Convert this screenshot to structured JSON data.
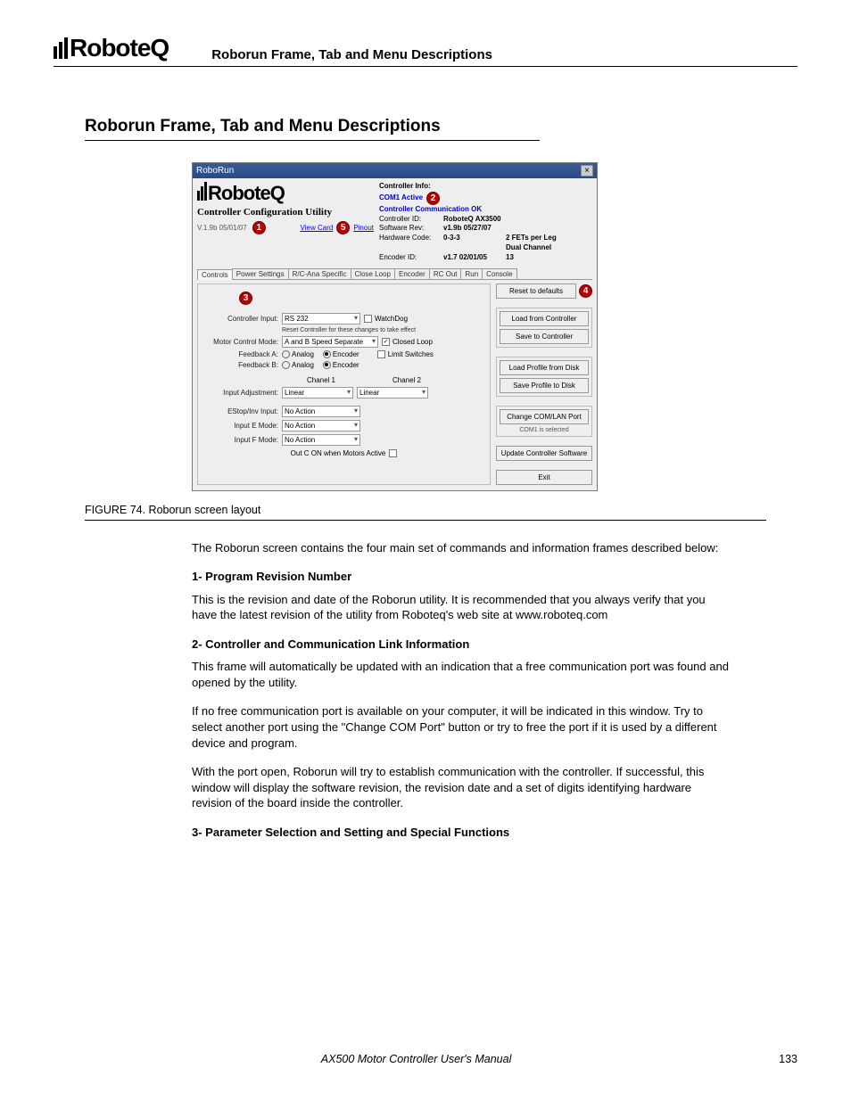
{
  "header": {
    "brand": "RoboteQ",
    "title": "Roborun Frame, Tab and Menu Descriptions"
  },
  "section_title": "Roborun Frame, Tab and Menu Descriptions",
  "shot": {
    "window_title": "RoboRun",
    "close_glyph": "×",
    "logo": "RoboteQ",
    "utility": "Controller Configuration Utility",
    "version": "V.1.9b 05/01/07",
    "callout1": "1",
    "callout2": "2",
    "callout3": "3",
    "callout4": "4",
    "callout5": "5",
    "link_viewcard": "View Card",
    "link_pinout": "Pinout",
    "info": {
      "heading": "Controller Info:",
      "active": "COM1 Active",
      "comm": "Controller Communication OK",
      "id_lab": "Controller ID:",
      "id_val": "RoboteQ AX3500",
      "sw_lab": "Software Rev:",
      "sw_val": "v1.9b 05/27/07",
      "hw_lab": "Hardware Code:",
      "hw_val": "0-3-3",
      "hw_extra": "2 FETs per Leg",
      "dual": "Dual Channel",
      "enc_lab": "Encoder ID:",
      "enc_val": "v1.7  02/01/05",
      "enc_extra": "13"
    },
    "tabs": [
      "Controls",
      "Power Settings",
      "R/C-Ana Specific",
      "Close Loop",
      "Encoder",
      "RC Out",
      "Run",
      "Console"
    ],
    "form": {
      "controller_input_lab": "Controller Input:",
      "controller_input_val": "RS 232",
      "watchdog": "WatchDog",
      "reset_note": "Reset Controller for these changes to take effect",
      "motor_mode_lab": "Motor Control Mode:",
      "motor_mode_val": "A and B Speed Separate",
      "closed_loop": "Closed Loop",
      "feedback_a_lab": "Feedback A:",
      "feedback_b_lab": "Feedback B:",
      "analog": "Analog",
      "encoder": "Encoder",
      "limit": "Limit Switches",
      "chanel1": "Chanel 1",
      "chanel2": "Chanel 2",
      "input_adj_lab": "Input Adjustment:",
      "linear": "Linear",
      "estop_lab": "EStop/Inv Input:",
      "e_mode_lab": "Input E Mode:",
      "f_mode_lab": "Input F Mode:",
      "no_action": "No Action",
      "out_c": "Out C ON when Motors Active"
    },
    "buttons": {
      "reset": "Reset to defaults",
      "load_ctrl": "Load from Controller",
      "save_ctrl": "Save to Controller",
      "load_disk": "Load Profile from Disk",
      "save_disk": "Save Profile to Disk",
      "change_port": "Change COM/LAN Port",
      "com_sel": "COM1 is selected",
      "update": "Update Controller Software",
      "exit": "Exit"
    }
  },
  "figure_caption": "FIGURE 74. Roborun screen layout",
  "body": {
    "intro": "The Roborun screen contains the four main set of commands and information frames described below:",
    "h1": "1- Program Revision Number",
    "p1": "This is the revision and date of the Roborun utility. It is recommended that you always verify that you have the latest revision of the utility from Roboteq's web site at www.roboteq.com",
    "h2": "2- Controller and Communication Link Information",
    "p2a": "This frame will automatically be updated with an indication that a free communication port was found and opened by the utility.",
    "p2b": "If no free communication port is available on your computer, it will be indicated in this window. Try to select another port using the \"Change COM Port\" button or try to free the port if it is used by a different device and program.",
    "p2c": "With the port open, Roborun will try to establish communication with the controller. If successful, this window will display the software revision, the revision date and a set of digits identifying hardware revision of the board inside the controller.",
    "h3": "3- Parameter Selection and Setting and Special Functions"
  },
  "footer": {
    "title": "AX500 Motor Controller User's Manual",
    "page": "133"
  }
}
